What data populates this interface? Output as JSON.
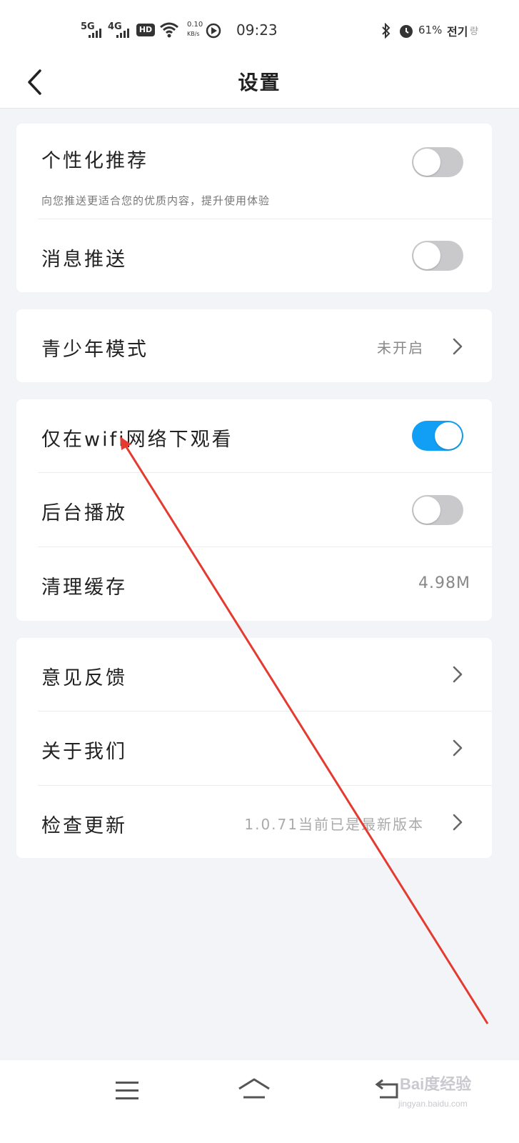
{
  "status_bar": {
    "signal_5g": "5G",
    "signal_4g": "4G",
    "hd": "HD",
    "net_speed": "0.10",
    "net_speed_unit": "KB/s",
    "time": "09:23",
    "battery": "61%",
    "carrier": "전기",
    "carrier_suffix": "량"
  },
  "header": {
    "title": "设置"
  },
  "groups": [
    {
      "items": [
        {
          "label": "个性化推荐",
          "subtitle": "向您推送更适合您的优质内容，提升使用体验",
          "toggle_on": false
        },
        {
          "label": "消息推送",
          "toggle_on": false
        }
      ]
    },
    {
      "items": [
        {
          "label": "青少年模式",
          "value": "未开启"
        }
      ]
    },
    {
      "items": [
        {
          "label": "仅在wifi网络下观看",
          "toggle_on": true
        },
        {
          "label": "后台播放",
          "toggle_on": false
        },
        {
          "label": "清理缓存",
          "value": "4.98M"
        }
      ]
    },
    {
      "items": [
        {
          "label": "意见反馈"
        },
        {
          "label": "关于我们"
        },
        {
          "label": "检查更新",
          "value": "1.0.71当前已是最新版本"
        }
      ]
    }
  ],
  "colors": {
    "accent": "#119ff5",
    "toggle_off": "#c9c9cc",
    "background": "#f3f4f8",
    "annotation_arrow": "#e53a2f"
  },
  "watermark": {
    "text": "Bai度经验",
    "sub": "jingyan.baidu.com"
  }
}
